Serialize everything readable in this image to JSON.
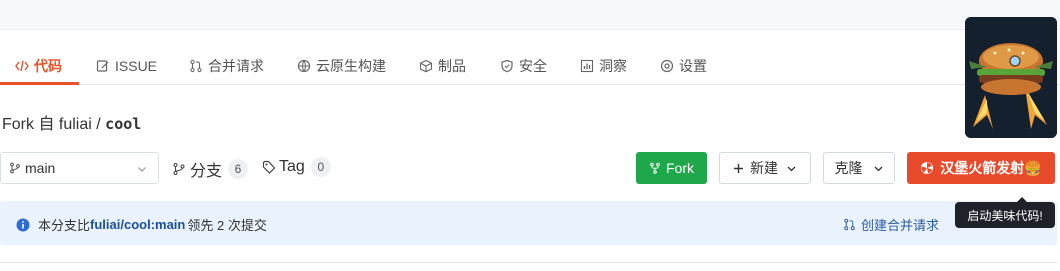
{
  "tabs": [
    {
      "label": "代码",
      "icon": "code-icon",
      "active": true
    },
    {
      "label": "ISSUE",
      "icon": "issue-icon"
    },
    {
      "label": "合并请求",
      "icon": "pull-request-icon"
    },
    {
      "label": "云原生构建",
      "icon": "build-icon"
    },
    {
      "label": "制品",
      "icon": "package-icon"
    },
    {
      "label": "安全",
      "icon": "shield-icon"
    },
    {
      "label": "洞察",
      "icon": "chart-icon"
    },
    {
      "label": "设置",
      "icon": "gear-icon"
    }
  ],
  "fork": {
    "prefix": "Fork 自",
    "owner": "fuliai",
    "separator": "/",
    "repo": "cool"
  },
  "branch": {
    "current": "main"
  },
  "stats": {
    "branches_label": "分支",
    "branches_count": "6",
    "tags_label": "Tag",
    "tags_count": "0"
  },
  "buttons": {
    "fork": "Fork",
    "new": "新建",
    "clone": "克隆",
    "launch": "汉堡火箭发射🍔"
  },
  "info": {
    "prefix": "本分支比",
    "ref": "fuliai/cool:main",
    "suffix": "领先 2 次提交"
  },
  "pr_link": "创建合并请求",
  "tooltip": "启动美味代码!",
  "colors": {
    "accent": "#e8532b",
    "fork_green": "#1fa84a",
    "launch_red": "#e84b2c",
    "info_bg": "#eaf2fd"
  }
}
